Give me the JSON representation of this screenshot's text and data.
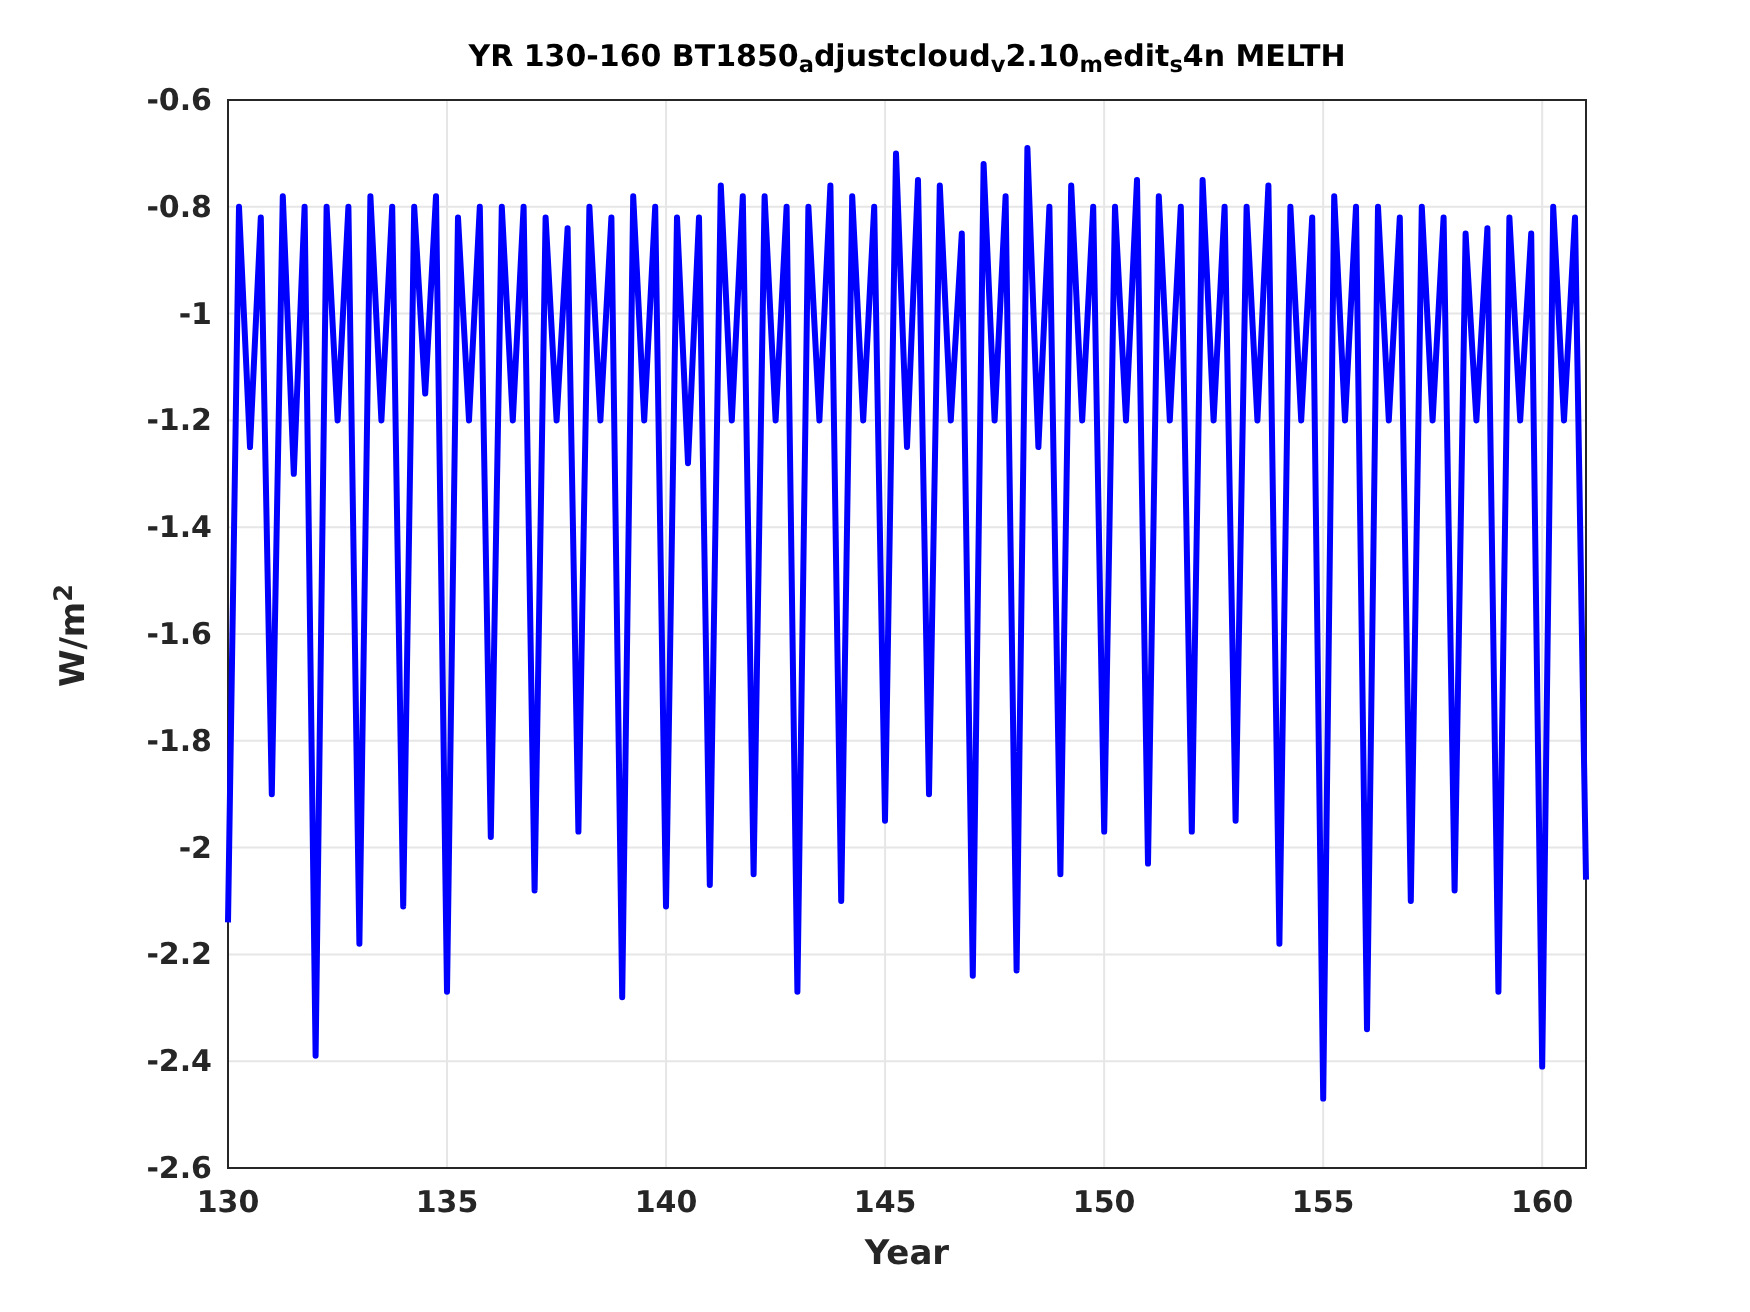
{
  "figure": {
    "chart_data": {
      "type": "line",
      "title": "YR 130-160 BT1850$_{a}$djustcloud$_{v}$2.10$_{m}$edit$_{s}$4n MELTH",
      "xlabel": "Year",
      "ylabel": "W/m$^{2}$",
      "x": [
        130,
        130.25,
        130.5,
        130.75,
        131,
        131.25,
        131.5,
        131.75,
        132,
        132.25,
        132.5,
        132.75,
        133,
        133.25,
        133.5,
        133.75,
        134,
        134.25,
        134.5,
        134.75,
        135,
        135.25,
        135.5,
        135.75,
        136,
        136.25,
        136.5,
        136.75,
        137,
        137.25,
        137.5,
        137.75,
        138,
        138.25,
        138.5,
        138.75,
        139,
        139.25,
        139.5,
        139.75,
        140,
        140.25,
        140.5,
        140.75,
        141,
        141.25,
        141.5,
        141.75,
        142,
        142.25,
        142.5,
        142.75,
        143,
        143.25,
        143.5,
        143.75,
        144,
        144.25,
        144.5,
        144.75,
        145,
        145.25,
        145.5,
        145.75,
        146,
        146.25,
        146.5,
        146.75,
        147,
        147.25,
        147.5,
        147.75,
        148,
        148.25,
        148.5,
        148.75,
        149,
        149.25,
        149.5,
        149.75,
        150,
        150.25,
        150.5,
        150.75,
        151,
        151.25,
        151.5,
        151.75,
        152,
        152.25,
        152.5,
        152.75,
        153,
        153.25,
        153.5,
        153.75,
        154,
        154.25,
        154.5,
        154.75,
        155,
        155.25,
        155.5,
        155.75,
        156,
        156.25,
        156.5,
        156.75,
        157,
        157.25,
        157.5,
        157.75,
        158,
        158.25,
        158.5,
        158.75,
        159,
        159.25,
        159.5,
        159.75,
        160,
        160.25,
        160.5,
        160.75,
        161
      ],
      "series": [
        {
          "color": "#0000ff",
          "values": [
            -2.14,
            -0.8,
            -1.25,
            -0.82,
            -1.9,
            -0.78,
            -1.3,
            -0.8,
            -2.39,
            -0.8,
            -1.2,
            -0.8,
            -2.18,
            -0.78,
            -1.2,
            -0.8,
            -2.11,
            -0.8,
            -1.15,
            -0.78,
            -2.27,
            -0.82,
            -1.2,
            -0.8,
            -1.98,
            -0.8,
            -1.2,
            -0.8,
            -2.08,
            -0.82,
            -1.2,
            -0.84,
            -1.97,
            -0.8,
            -1.2,
            -0.82,
            -2.28,
            -0.78,
            -1.2,
            -0.8,
            -2.11,
            -0.82,
            -1.28,
            -0.82,
            -2.07,
            -0.76,
            -1.2,
            -0.78,
            -2.05,
            -0.78,
            -1.2,
            -0.8,
            -2.27,
            -0.8,
            -1.2,
            -0.76,
            -2.1,
            -0.78,
            -1.2,
            -0.8,
            -1.95,
            -0.7,
            -1.25,
            -0.75,
            -1.9,
            -0.76,
            -1.2,
            -0.85,
            -2.24,
            -0.72,
            -1.2,
            -0.78,
            -2.23,
            -0.69,
            -1.25,
            -0.8,
            -2.05,
            -0.76,
            -1.2,
            -0.8,
            -1.97,
            -0.8,
            -1.2,
            -0.75,
            -2.03,
            -0.78,
            -1.2,
            -0.8,
            -1.97,
            -0.75,
            -1.2,
            -0.8,
            -1.95,
            -0.8,
            -1.2,
            -0.76,
            -2.18,
            -0.8,
            -1.2,
            -0.82,
            -2.47,
            -0.78,
            -1.2,
            -0.8,
            -2.34,
            -0.8,
            -1.2,
            -0.82,
            -2.1,
            -0.8,
            -1.2,
            -0.82,
            -2.08,
            -0.85,
            -1.2,
            -0.84,
            -2.27,
            -0.82,
            -1.2,
            -0.85,
            -2.41,
            -0.8,
            -1.2,
            -0.82,
            -2.06
          ]
        }
      ],
      "grid": true,
      "xlim": [
        130,
        161
      ],
      "ylim": [
        -2.6,
        -0.6
      ],
      "xticks": [
        130,
        135,
        140,
        145,
        150,
        155,
        160
      ],
      "yticks": [
        {
          "value": -2.6,
          "label": "-2.6"
        },
        {
          "value": -2.4,
          "label": "-2.4"
        },
        {
          "value": -2.2,
          "label": "-2.2"
        },
        {
          "value": -2,
          "label": "-2"
        },
        {
          "value": -1.8,
          "label": "-1.8"
        },
        {
          "value": -1.6,
          "label": "-1.6"
        },
        {
          "value": -1.4,
          "label": "-1.4"
        },
        {
          "value": -1.2,
          "label": "-1.2"
        },
        {
          "value": -1,
          "label": "-1"
        },
        {
          "value": -0.8,
          "label": "-0.8"
        },
        {
          "value": -0.6,
          "label": "-0.6"
        }
      ]
    }
  }
}
